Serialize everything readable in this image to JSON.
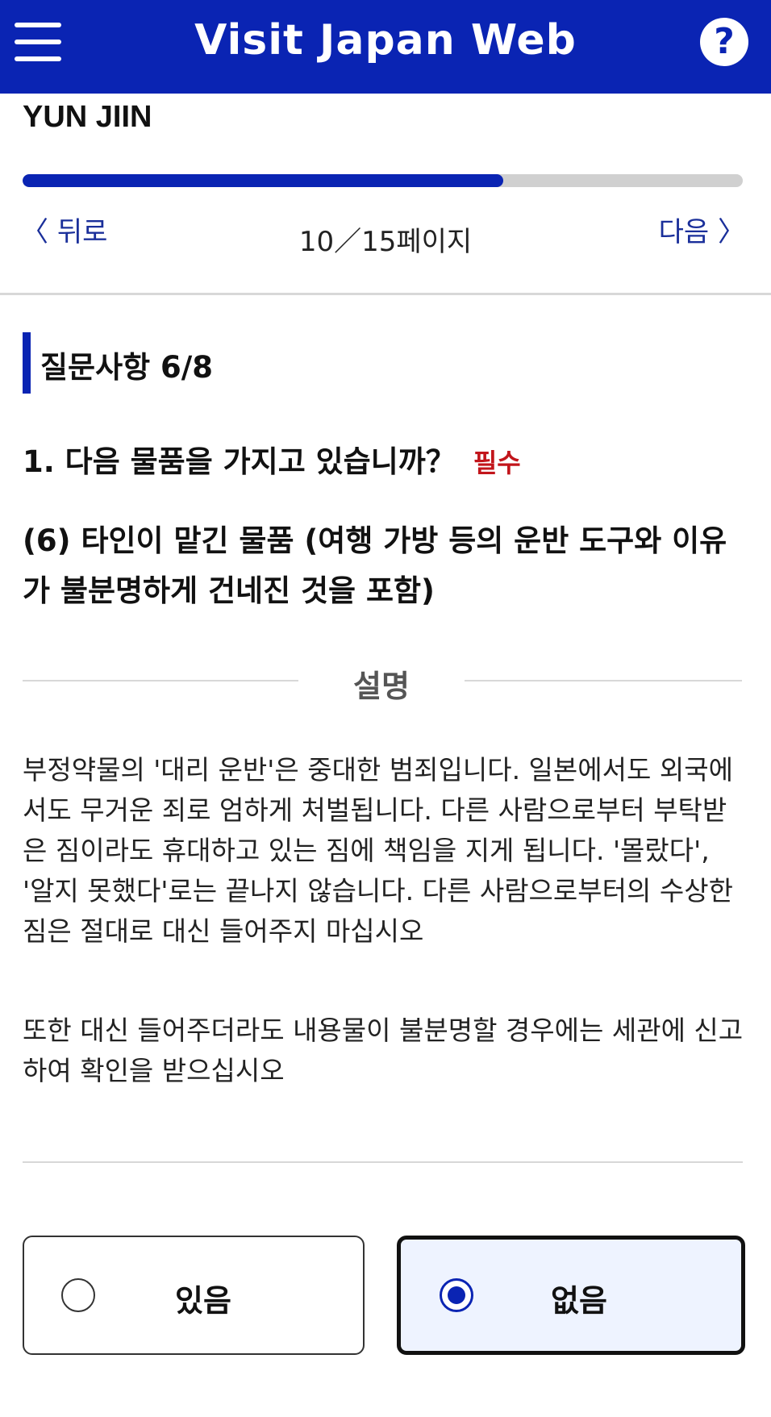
{
  "header": {
    "title": "Visit Japan Web",
    "help_label": "?",
    "menu_icon": "hamburger-menu-icon"
  },
  "user": {
    "name": "YUN JIIN"
  },
  "progress": {
    "fraction": 0.667,
    "color": "#0a24b3"
  },
  "nav": {
    "back_label": "뒤로",
    "next_label": "다음",
    "page_counter": "10／15페이지",
    "back_icon": "chevron-left-icon",
    "next_icon": "chevron-right-icon"
  },
  "section": {
    "title": "질문사항 6/8"
  },
  "question": {
    "text": "1. 다음 물품을 가지고 있습니까？",
    "required_label": "필수",
    "subquestion": "(6) 타인이 맡긴 물품 (여행 가방 등의 운반 도구와 이유가 불분명하게 건네진 것을 포함)"
  },
  "description": {
    "title": "설명",
    "paragraph1": "부정약물의 '대리 운반'은 중대한 범죄입니다. 일본에서도 외국에서도 무거운 죄로 엄하게 처벌됩니다. 다른 사람으로부터 부탁받은 짐이라도 휴대하고 있는 짐에 책임을 지게 됩니다. '몰랐다', '알지 못했다'로는 끝나지 않습니다. 다른 사람으로부터의 수상한 짐은 절대로 대신 들어주지 마십시오",
    "paragraph2": "또한 대신 들어주더라도 내용물이 불분명할 경우에는 세관에 신고하여 확인을 받으십시오"
  },
  "options": {
    "yes_label": "있음",
    "no_label": "없음",
    "selected": "없음"
  },
  "colors": {
    "brand": "#0a24b3",
    "required": "#c2151b",
    "selected_bg": "#eef3ff"
  }
}
